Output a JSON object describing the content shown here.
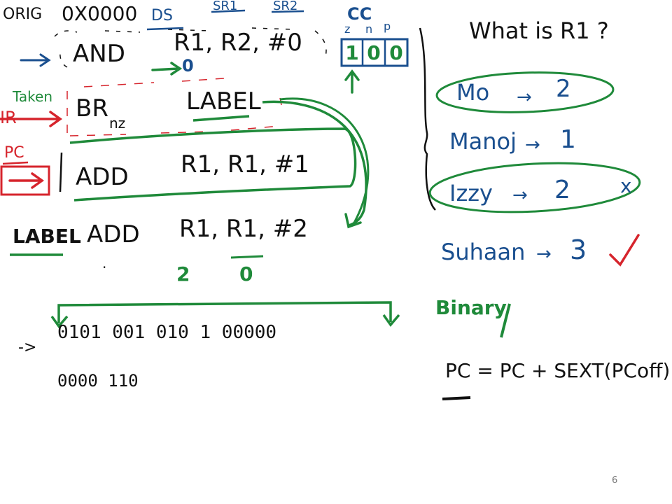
{
  "header": {
    "orig": "ORIG",
    "orig_addr": "0X0000",
    "col_ds": "DS",
    "col_sr1": "SR1",
    "col_sr2": "SR2",
    "cc_title": "CC",
    "cc_flags": [
      "z",
      "n",
      "p"
    ],
    "cc_values": [
      "1",
      "0",
      "0"
    ],
    "and_result_hint": "0"
  },
  "registers": {
    "ir": "IR",
    "pc": "PC",
    "taken": "Taken"
  },
  "code": [
    {
      "label": "",
      "op": "AND",
      "operands": "R1, R2, #0",
      "cond": ""
    },
    {
      "label": "",
      "op": "BR",
      "operands": "LABEL",
      "cond": "nz"
    },
    {
      "label": "",
      "op": "ADD",
      "operands": "R1, R1, #1",
      "cond": ""
    },
    {
      "label": "LABEL",
      "op": "ADD",
      "operands": "R1, R1, #2",
      "cond": ""
    }
  ],
  "annotations": {
    "r1_before": "2",
    "r1_after": "0",
    "dot": "."
  },
  "binary": {
    "arrow": "->",
    "line1": "0101  001  010  1  00000",
    "line2": "0000  110"
  },
  "quiz": {
    "question": "What is R1 ?",
    "answers": [
      {
        "name": "Mo",
        "value": "2",
        "mark": ""
      },
      {
        "name": "Manoj",
        "value": "1",
        "mark": ""
      },
      {
        "name": "Izzy",
        "value": "2",
        "mark": "x"
      },
      {
        "name": "Suhaan",
        "value": "3",
        "mark": "check"
      }
    ]
  },
  "notes": {
    "binary_word": "Binary",
    "formula": "PC = PC + SEXT(PCoff)"
  },
  "page_number": "6",
  "colors": {
    "ink_black": "#111111",
    "ink_blue": "#1a4f8f",
    "ink_green": "#1f8a3a",
    "ink_red": "#d6242c"
  }
}
